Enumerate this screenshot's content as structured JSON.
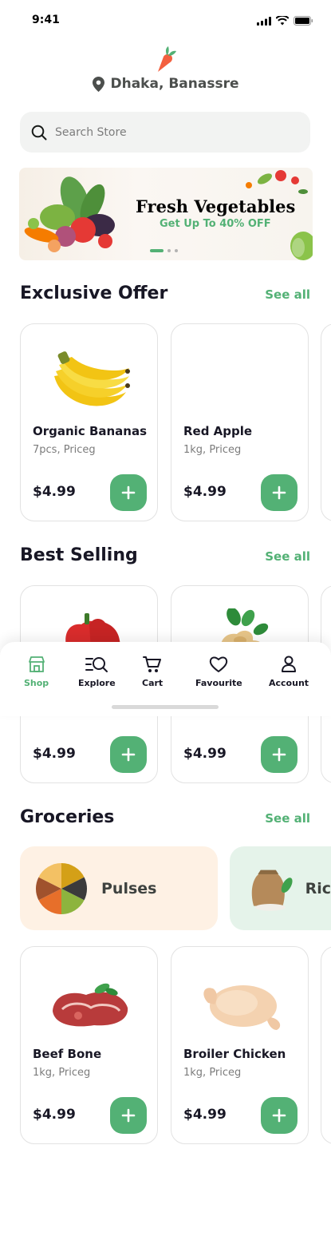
{
  "status": {
    "time": "9:41"
  },
  "location": {
    "text": "Dhaka, Banassre"
  },
  "search": {
    "placeholder": "Search Store"
  },
  "banner": {
    "title": "Fresh Vegetables",
    "subtitle": "Get Up To 40% OFF"
  },
  "sections": {
    "exclusive": {
      "title": "Exclusive Offer",
      "see_all": "See all"
    },
    "best": {
      "title": "Best Selling",
      "see_all": "See all"
    },
    "groceries": {
      "title": "Groceries",
      "see_all": "See all"
    }
  },
  "exclusive_products": [
    {
      "name": "Organic Bananas",
      "qty": "7pcs, Priceg",
      "price": "$4.99",
      "icon": "banana-icon"
    },
    {
      "name": "Red Apple",
      "qty": "1kg, Priceg",
      "price": "$4.99",
      "icon": "apple-icon"
    }
  ],
  "best_products": [
    {
      "name": "",
      "qty": "",
      "price": "$4.99",
      "icon": "bell-pepper-icon"
    },
    {
      "name": "",
      "qty": "",
      "price": "$4.99",
      "icon": "ginger-icon"
    }
  ],
  "grocery_categories": [
    {
      "label": "Pulses",
      "bg": "#FEF1E4",
      "icon": "pulses-icon"
    },
    {
      "label": "Ric",
      "bg": "#E5F3EA",
      "icon": "rice-sack-icon"
    }
  ],
  "meat_products": [
    {
      "name": "Beef Bone",
      "qty": "1kg, Priceg",
      "price": "$4.99",
      "icon": "beef-icon"
    },
    {
      "name": "Broiler Chicken",
      "qty": "1kg, Priceg",
      "price": "$4.99",
      "icon": "chicken-icon"
    }
  ],
  "tabs": [
    {
      "label": "Shop",
      "icon": "shop-icon",
      "active": true
    },
    {
      "label": "Explore",
      "icon": "explore-icon",
      "active": false
    },
    {
      "label": "Cart",
      "icon": "cart-icon",
      "active": false
    },
    {
      "label": "Favourite",
      "icon": "heart-icon",
      "active": false
    },
    {
      "label": "Account",
      "icon": "account-icon",
      "active": false
    }
  ],
  "colors": {
    "accent": "#53B175",
    "text": "#181725",
    "muted": "#7C7C7C",
    "border": "#E2E2E2"
  }
}
